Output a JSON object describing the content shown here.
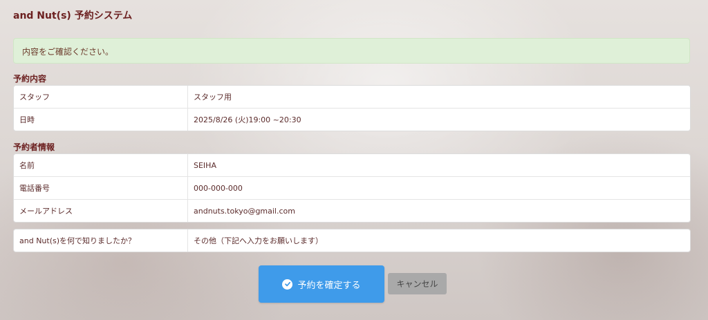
{
  "app": {
    "title": "and Nut(s) 予約システム"
  },
  "alert": {
    "message": "内容をご確認ください。"
  },
  "reservation": {
    "heading": "予約内容",
    "rows": [
      {
        "label": "スタッフ",
        "value": "スタッフ用"
      },
      {
        "label": "日時",
        "value": "2025/8/26 (火)19:00 ~20:30"
      }
    ]
  },
  "booker": {
    "heading": "予約者情報",
    "rows": [
      {
        "label": "名前",
        "value": "SEIHA"
      },
      {
        "label": "電話番号",
        "value": "000-000-000"
      },
      {
        "label": "メールアドレス",
        "value": "andnuts.tokyo@gmail.com"
      }
    ]
  },
  "survey": {
    "rows": [
      {
        "label": "and Nut(s)を何で知りましたか？",
        "value": "その他（下記へ入力をお願いします）"
      }
    ]
  },
  "actions": {
    "confirm_label": "予約を確定する",
    "cancel_label": "キャンセル",
    "confirm_icon": "check-circle-icon"
  },
  "colors": {
    "accent": "#3f9bea",
    "alert_bg": "#dff0d8",
    "heading": "#6b1f1f",
    "cancel_bg": "#a9a9a9"
  }
}
